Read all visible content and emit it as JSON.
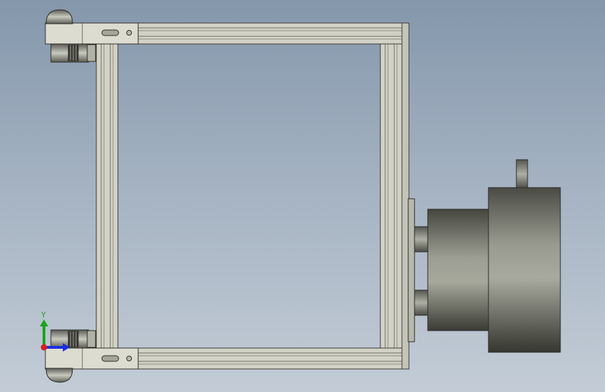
{
  "window": {
    "title": ""
  },
  "viewport": {
    "background_top": "#8497ab",
    "background_bottom": "#c3ccd6"
  },
  "model": {
    "components": [
      "extrusion-frame",
      "caster-wheel",
      "caster-wheel",
      "mounting-bracket",
      "mounting-bracket",
      "drive-motor"
    ]
  },
  "triad": {
    "y_label": "Y",
    "x_color": "#1c2ee0",
    "y_color": "#1aa51a",
    "z_color": "#d81e1e"
  }
}
